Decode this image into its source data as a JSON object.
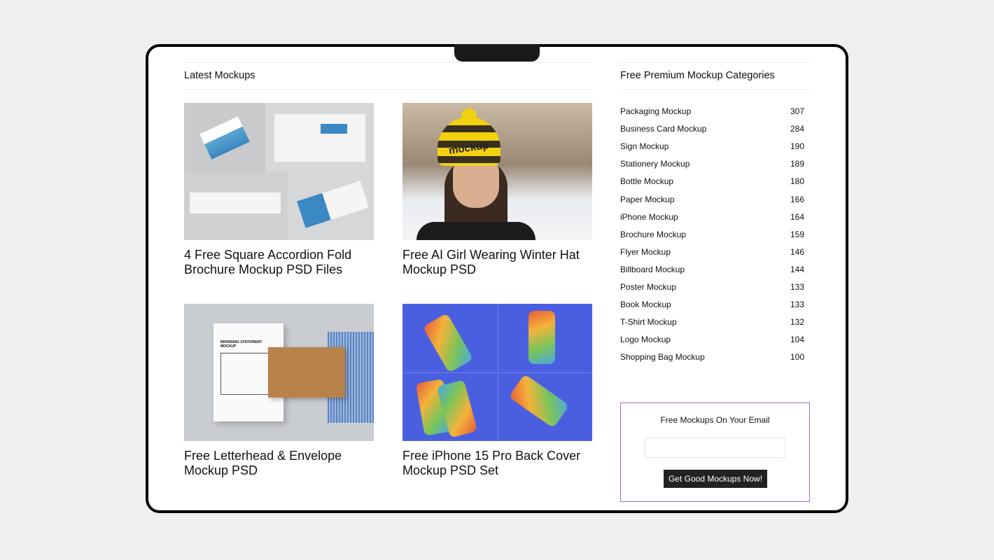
{
  "latest": {
    "heading": "Latest Mockups",
    "posts": [
      {
        "title": "4 Free Square Accordion Fold Brochure Mockup PSD Files"
      },
      {
        "title": "Free AI Girl Wearing Winter Hat Mockup PSD",
        "image_text": "mockup"
      },
      {
        "title": "Free Letterhead & Envelope Mockup PSD",
        "image_text": "BRANDING STATIONERY MOCKUP"
      },
      {
        "title": "Free iPhone 15 Pro Back Cover Mockup PSD Set"
      }
    ]
  },
  "sidebar": {
    "heading": "Free Premium Mockup Categories",
    "categories": [
      {
        "name": "Packaging Mockup",
        "count": "307"
      },
      {
        "name": "Business Card Mockup",
        "count": "284"
      },
      {
        "name": "Sign Mockup",
        "count": "190"
      },
      {
        "name": "Stationery Mockup",
        "count": "189"
      },
      {
        "name": "Bottle Mockup",
        "count": "180"
      },
      {
        "name": "Paper Mockup",
        "count": "166"
      },
      {
        "name": "iPhone Mockup",
        "count": "164"
      },
      {
        "name": "Brochure Mockup",
        "count": "159"
      },
      {
        "name": "Flyer Mockup",
        "count": "146"
      },
      {
        "name": "Billboard Mockup",
        "count": "144"
      },
      {
        "name": "Poster Mockup",
        "count": "133"
      },
      {
        "name": "Book Mockup",
        "count": "133"
      },
      {
        "name": "T-Shirt Mockup",
        "count": "132"
      },
      {
        "name": "Logo Mockup",
        "count": "104"
      },
      {
        "name": "Shopping Bag Mockup",
        "count": "100"
      }
    ],
    "newsletter": {
      "title": "Free Mockups On Your Email",
      "email_value": "",
      "button": "Get Good Mockups Now!"
    }
  },
  "colors": {
    "newsletter_border": "#9b6fd6",
    "button_bg": "#222222",
    "phone_bg": "#4a5fe0"
  }
}
